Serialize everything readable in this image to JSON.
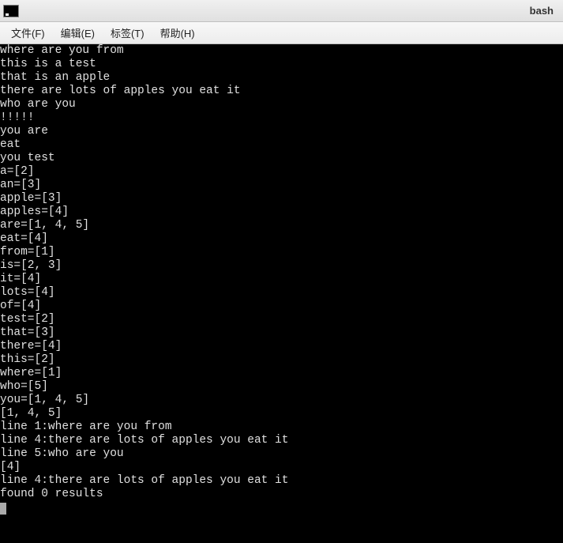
{
  "window": {
    "title": "bash"
  },
  "menu": {
    "file": "文件(F)",
    "edit": "编辑(E)",
    "tabs": "标签(T)",
    "help": "帮助(H)"
  },
  "terminal": {
    "lines": [
      "where are you from",
      "this is a test",
      "that is an apple",
      "there are lots of apples you eat it",
      "who are you",
      "!!!!!",
      "you are",
      "eat",
      "you test",
      "a=[2]",
      "an=[3]",
      "apple=[3]",
      "apples=[4]",
      "are=[1, 4, 5]",
      "eat=[4]",
      "from=[1]",
      "is=[2, 3]",
      "it=[4]",
      "lots=[4]",
      "of=[4]",
      "test=[2]",
      "that=[3]",
      "there=[4]",
      "this=[2]",
      "where=[1]",
      "who=[5]",
      "you=[1, 4, 5]",
      "[1, 4, 5]",
      "line 1:where are you from",
      "line 4:there are lots of apples you eat it",
      "line 5:who are you",
      "[4]",
      "line 4:there are lots of apples you eat it",
      "found 0 results"
    ]
  }
}
